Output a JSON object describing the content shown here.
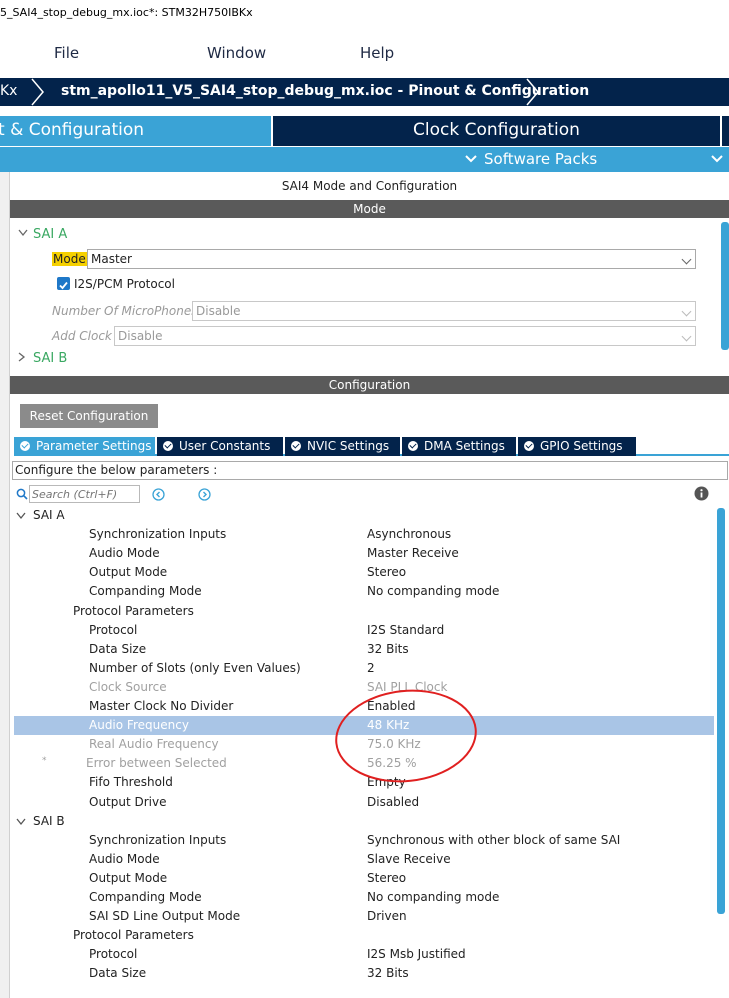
{
  "window": {
    "title": "5_SAI4_stop_debug_mx.ioc*: STM32H750IBKx"
  },
  "menu": {
    "file": "File",
    "window": "Window",
    "help": "Help"
  },
  "breadcrumb": {
    "prev": "Kx",
    "current": "stm_apollo11_V5_SAI4_stop_debug_mx.ioc - Pinout & Configuration"
  },
  "tabs": {
    "pinout": "t & Configuration",
    "clock": "Clock Configuration",
    "software_packs": "Software Packs"
  },
  "colors": {
    "accent_blue": "#3aa3d6",
    "navy": "#03234b",
    "green_label": "#3aa862",
    "highlight_yellow": "#f5d000",
    "annotation_red": "#e02020",
    "selected_row": "#a9c5e6"
  },
  "panel_title": "SAI4 Mode and Configuration",
  "mode_section": {
    "header": "Mode",
    "sai_a": "SAI A",
    "mode_label": "Mode",
    "mode_value": "Master",
    "i2s_label": "I2S/PCM Protocol",
    "i2s_checked": true,
    "mic_label": "Number Of MicroPhones",
    "mic_value": "Disable",
    "clock_label": "Add Clock",
    "clock_value": "Disable",
    "sai_b": "SAI B"
  },
  "config_section": {
    "header": "Configuration",
    "reset_button": "Reset Configuration",
    "subtabs": [
      "Parameter Settings",
      "User Constants",
      "NVIC Settings",
      "DMA Settings",
      "GPIO Settings"
    ],
    "configure_text": "Configure the below parameters :",
    "search_placeholder": "Search (Ctrl+F)",
    "info_icon": "info-icon"
  },
  "params": [
    {
      "name": "SAI A",
      "value": "",
      "kind": "group"
    },
    {
      "name": "Synchronization Inputs",
      "value": "Asynchronous",
      "kind": "param"
    },
    {
      "name": "Audio Mode",
      "value": "Master Receive",
      "kind": "param"
    },
    {
      "name": "Output Mode",
      "value": "Stereo",
      "kind": "param"
    },
    {
      "name": "Companding Mode",
      "value": "No companding mode",
      "kind": "param"
    },
    {
      "name": "Protocol Parameters",
      "value": "",
      "kind": "subgroup"
    },
    {
      "name": "Protocol",
      "value": "I2S Standard",
      "kind": "param"
    },
    {
      "name": "Data Size",
      "value": "32 Bits",
      "kind": "param"
    },
    {
      "name": "Number of Slots (only Even Values)",
      "value": "2",
      "kind": "param"
    },
    {
      "name": "Clock Source",
      "value": "SAI PLL Clock",
      "kind": "dim"
    },
    {
      "name": "Master Clock No Divider",
      "value": "Enabled",
      "kind": "param"
    },
    {
      "name": "Audio Frequency",
      "value": "48 KHz",
      "kind": "selected"
    },
    {
      "name": "Real Audio Frequency",
      "value": "75.0 KHz",
      "kind": "dim"
    },
    {
      "name": "Error between Selected",
      "value": "56.25 %",
      "kind": "dim-star",
      "marker": "*"
    },
    {
      "name": "Fifo Threshold",
      "value": "Empty",
      "kind": "param"
    },
    {
      "name": "Output Drive",
      "value": "Disabled",
      "kind": "param"
    },
    {
      "name": "SAI B",
      "value": "",
      "kind": "group"
    },
    {
      "name": "Synchronization Inputs",
      "value": "Synchronous with other block of same SAI",
      "kind": "param"
    },
    {
      "name": "Audio Mode",
      "value": "Slave Receive",
      "kind": "param"
    },
    {
      "name": "Output Mode",
      "value": "Stereo",
      "kind": "param"
    },
    {
      "name": "Companding Mode",
      "value": "No companding mode",
      "kind": "param"
    },
    {
      "name": "SAI SD Line Output Mode",
      "value": "Driven",
      "kind": "param"
    },
    {
      "name": "Protocol Parameters",
      "value": "",
      "kind": "subgroup"
    },
    {
      "name": "Protocol",
      "value": "I2S Msb Justified",
      "kind": "param"
    },
    {
      "name": "Data Size",
      "value": "32 Bits",
      "kind": "param"
    }
  ]
}
